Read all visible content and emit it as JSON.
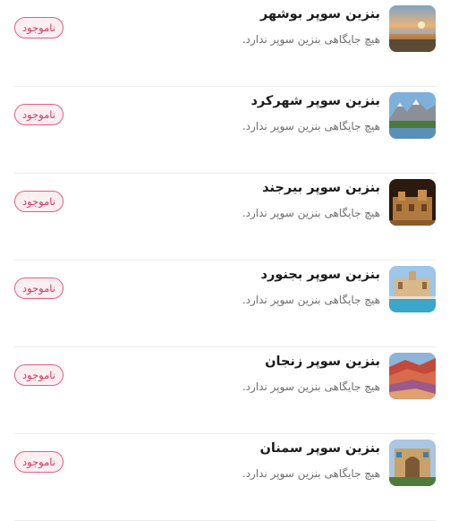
{
  "items": [
    {
      "title": "بنزین سوپر بوشهر",
      "subtitle": "هیچ جایگاهی بنزین سوپر ندارد.",
      "badge": "ناموجود",
      "image": "bushehr-photo"
    },
    {
      "title": "بنزین سوپر شهرکرد",
      "subtitle": "هیچ جایگاهی بنزین سوپر ندارد.",
      "badge": "ناموجود",
      "image": "shahrekord-photo"
    },
    {
      "title": "بنزین سوپر بیرجند",
      "subtitle": "هیچ جایگاهی بنزین سوپر ندارد.",
      "badge": "ناموجود",
      "image": "birjand-photo"
    },
    {
      "title": "بنزین سوپر بجنورد",
      "subtitle": "هیچ جایگاهی بنزین سوپر ندارد.",
      "badge": "ناموجود",
      "image": "bojnurd-photo"
    },
    {
      "title": "بنزین سوپر زنجان",
      "subtitle": "هیچ جایگاهی بنزین سوپر ندارد.",
      "badge": "ناموجود",
      "image": "zanjan-photo"
    },
    {
      "title": "بنزین سوپر سمنان",
      "subtitle": "هیچ جایگاهی بنزین سوپر ندارد.",
      "badge": "ناموجود",
      "image": "semnan-photo"
    }
  ],
  "colors": {
    "badge_text": "#d23a61",
    "badge_border": "#e0607e",
    "badge_bg": "#fdeef2",
    "title": "#1c1c1c",
    "subtitle": "#6f6f6f",
    "divider": "#ececec"
  }
}
